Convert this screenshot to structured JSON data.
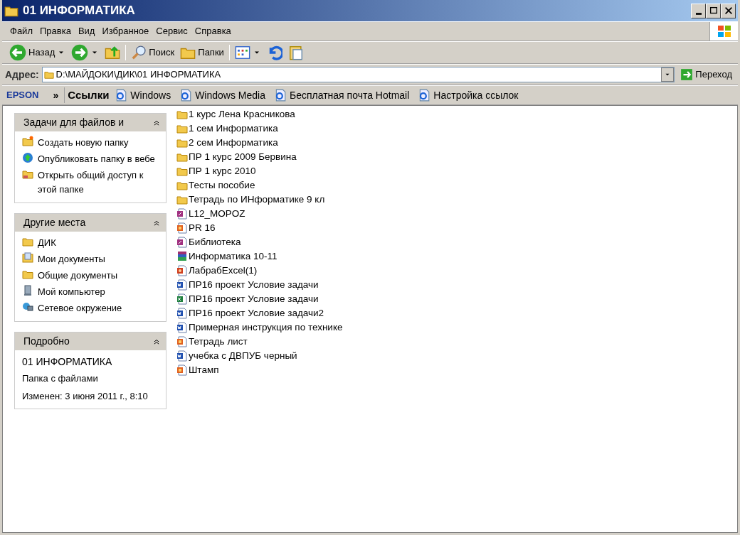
{
  "window": {
    "title": "01 ИНФОРМАТИКА"
  },
  "menu": [
    "Файл",
    "Правка",
    "Вид",
    "Избранное",
    "Сервис",
    "Справка"
  ],
  "toolbar": {
    "back": "Назад",
    "search": "Поиск",
    "folders": "Папки"
  },
  "address": {
    "label": "Адрес:",
    "value": "D:\\МАЙДОКИ\\ДИК\\01 ИНФОРМАТИКА",
    "go": "Переход"
  },
  "links_bar": {
    "brand": "EPSON",
    "chevron": "»",
    "title": "Ссылки",
    "links": [
      "Windows",
      "Windows Media",
      "Бесплатная почта Hotmail",
      "Настройка ссылок"
    ]
  },
  "panels": [
    {
      "title": "Задачи для файлов и",
      "items": [
        {
          "kind": "newfolder",
          "label": "Создать новую папку"
        },
        {
          "kind": "publish",
          "label": "Опубликовать папку в вебе"
        },
        {
          "kind": "share",
          "label": "Открыть общий доступ к этой папке"
        }
      ]
    },
    {
      "title": "Другие места",
      "items": [
        {
          "kind": "folder",
          "label": "ДИК"
        },
        {
          "kind": "mydocs",
          "label": "Мои документы"
        },
        {
          "kind": "folder",
          "label": "Общие документы"
        },
        {
          "kind": "computer",
          "label": "Мой компьютер"
        },
        {
          "kind": "network",
          "label": "Сетевое окружение"
        }
      ]
    },
    {
      "title": "Подробно",
      "details": {
        "name": "01 ИНФОРМАТИКА",
        "type": "Папка с файлами",
        "modified": "Изменен: 3 июня 2011 г., 8:10"
      }
    }
  ],
  "files": [
    {
      "kind": "folder",
      "name": "1 курс Лена Красникова"
    },
    {
      "kind": "folder",
      "name": "1 сем Информатика"
    },
    {
      "kind": "folder",
      "name": "2 сем Информатика"
    },
    {
      "kind": "folder",
      "name": "ПР 1 курс 2009 Бервина"
    },
    {
      "kind": "folder",
      "name": "ПР 1 курс 2010"
    },
    {
      "kind": "folder",
      "name": "Тесты пособие"
    },
    {
      "kind": "folder",
      "name": "Тетрадь по ИНформатике 9 кл"
    },
    {
      "kind": "publisher",
      "name": "L12_MOPOZ"
    },
    {
      "kind": "image",
      "name": "PR 16"
    },
    {
      "kind": "publisher",
      "name": "Библиотека"
    },
    {
      "kind": "archive",
      "name": "Информатика 10-11"
    },
    {
      "kind": "presentation",
      "name": "ЛабрабExcel(1)"
    },
    {
      "kind": "word",
      "name": "ПР16 проект Условие задачи"
    },
    {
      "kind": "excel",
      "name": "ПР16 проект Условие задачи"
    },
    {
      "kind": "word",
      "name": "ПР16 проект Условие задачи2"
    },
    {
      "kind": "word",
      "name": "Примерная инструкция по технике"
    },
    {
      "kind": "image",
      "name": "Тетрадь лист"
    },
    {
      "kind": "word",
      "name": "учебка с ДВПУБ черный"
    },
    {
      "kind": "image",
      "name": "Штамп"
    }
  ]
}
